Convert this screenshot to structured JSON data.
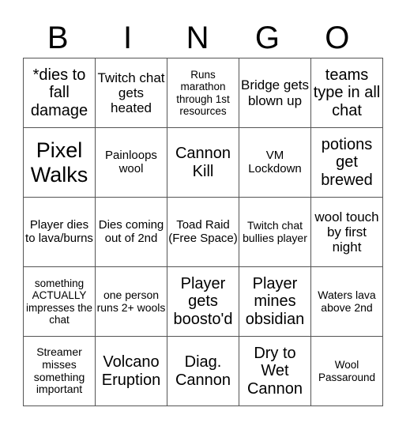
{
  "header": [
    "B",
    "I",
    "N",
    "G",
    "O"
  ],
  "rows": [
    [
      "*dies to fall damage",
      "Twitch chat gets heated",
      "Runs marathon through 1st resources",
      "Bridge gets blown up",
      "teams type in all chat"
    ],
    [
      "Pixel Walks",
      "Painloops wool",
      "Cannon Kill",
      "VM Lockdown",
      "potions get brewed"
    ],
    [
      "Player dies to lava/burns",
      "Dies coming out of 2nd",
      "Toad Raid (Free Space)",
      "Twitch chat bullies player",
      "wool touch by first night"
    ],
    [
      "something ACTUALLY impresses the chat",
      "one person runs 2+ wools",
      "Player gets boosto'd",
      "Player mines obsidian",
      "Waters lava above 2nd"
    ],
    [
      "Streamer misses something important",
      "Volcano Eruption",
      "Diag. Cannon",
      "Dry to Wet Cannon",
      "Wool Passaround"
    ]
  ]
}
